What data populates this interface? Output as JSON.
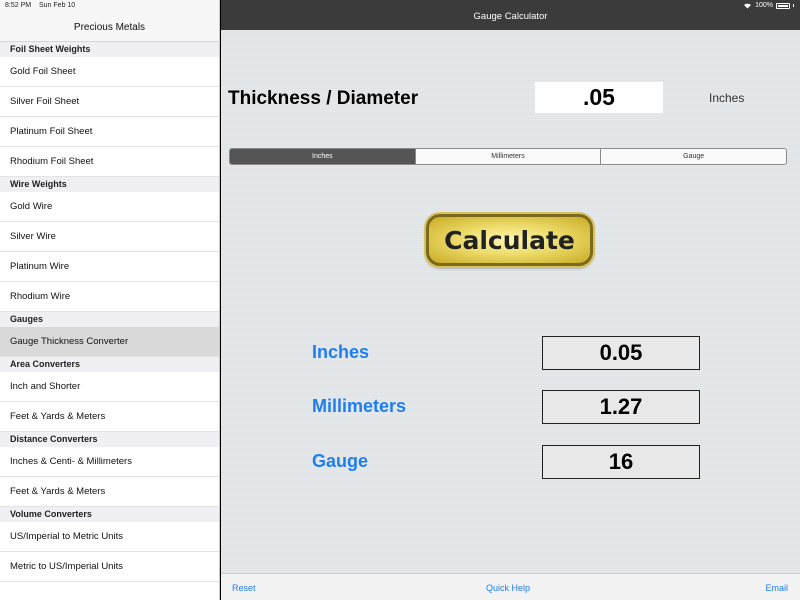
{
  "status": {
    "time": "8:52 PM",
    "date": "Sun Feb 10",
    "battery": "100%"
  },
  "sidebar": {
    "title": "Precious Metals",
    "sections": [
      {
        "header": "Foil Sheet Weights",
        "items": [
          "Gold Foil Sheet",
          "Silver Foil Sheet",
          "Platinum Foil Sheet",
          "Rhodium Foil Sheet"
        ]
      },
      {
        "header": "Wire Weights",
        "items": [
          "Gold Wire",
          "Silver Wire",
          "Platinum Wire",
          "Rhodium Wire"
        ]
      },
      {
        "header": "Gauges",
        "items": [
          "Gauge Thickness Converter"
        ]
      },
      {
        "header": "Area Converters",
        "items": [
          "Inch and Shorter",
          "Feet & Yards & Meters"
        ]
      },
      {
        "header": "Distance Converters",
        "items": [
          "Inches & Centi- & Millimeters",
          "Feet & Yards & Meters"
        ]
      },
      {
        "header": "Volume Converters",
        "items": [
          "US/Imperial to Metric Units",
          "Metric to US/Imperial Units"
        ]
      }
    ],
    "selected_item": "Gauge Thickness Converter"
  },
  "main": {
    "title": "Gauge Calculator",
    "thickness_label": "Thickness / Diameter",
    "input_value": ".05",
    "unit_label": "Inches",
    "segments": [
      "Inches",
      "Millimeters",
      "Gauge"
    ],
    "active_segment": "Inches",
    "calculate_label": "Calculate",
    "results": {
      "inches_label": "Inches",
      "inches_value": "0.05",
      "mm_label": "Millimeters",
      "mm_value": "1.27",
      "gauge_label": "Gauge",
      "gauge_value": "16"
    }
  },
  "toolbar": {
    "reset": "Reset",
    "quick_help": "Quick Help",
    "email": "Email"
  },
  "colors": {
    "accent": "#1e7ef0",
    "navbar": "#3b3b3b",
    "button_gold": "#ecdb6a"
  }
}
